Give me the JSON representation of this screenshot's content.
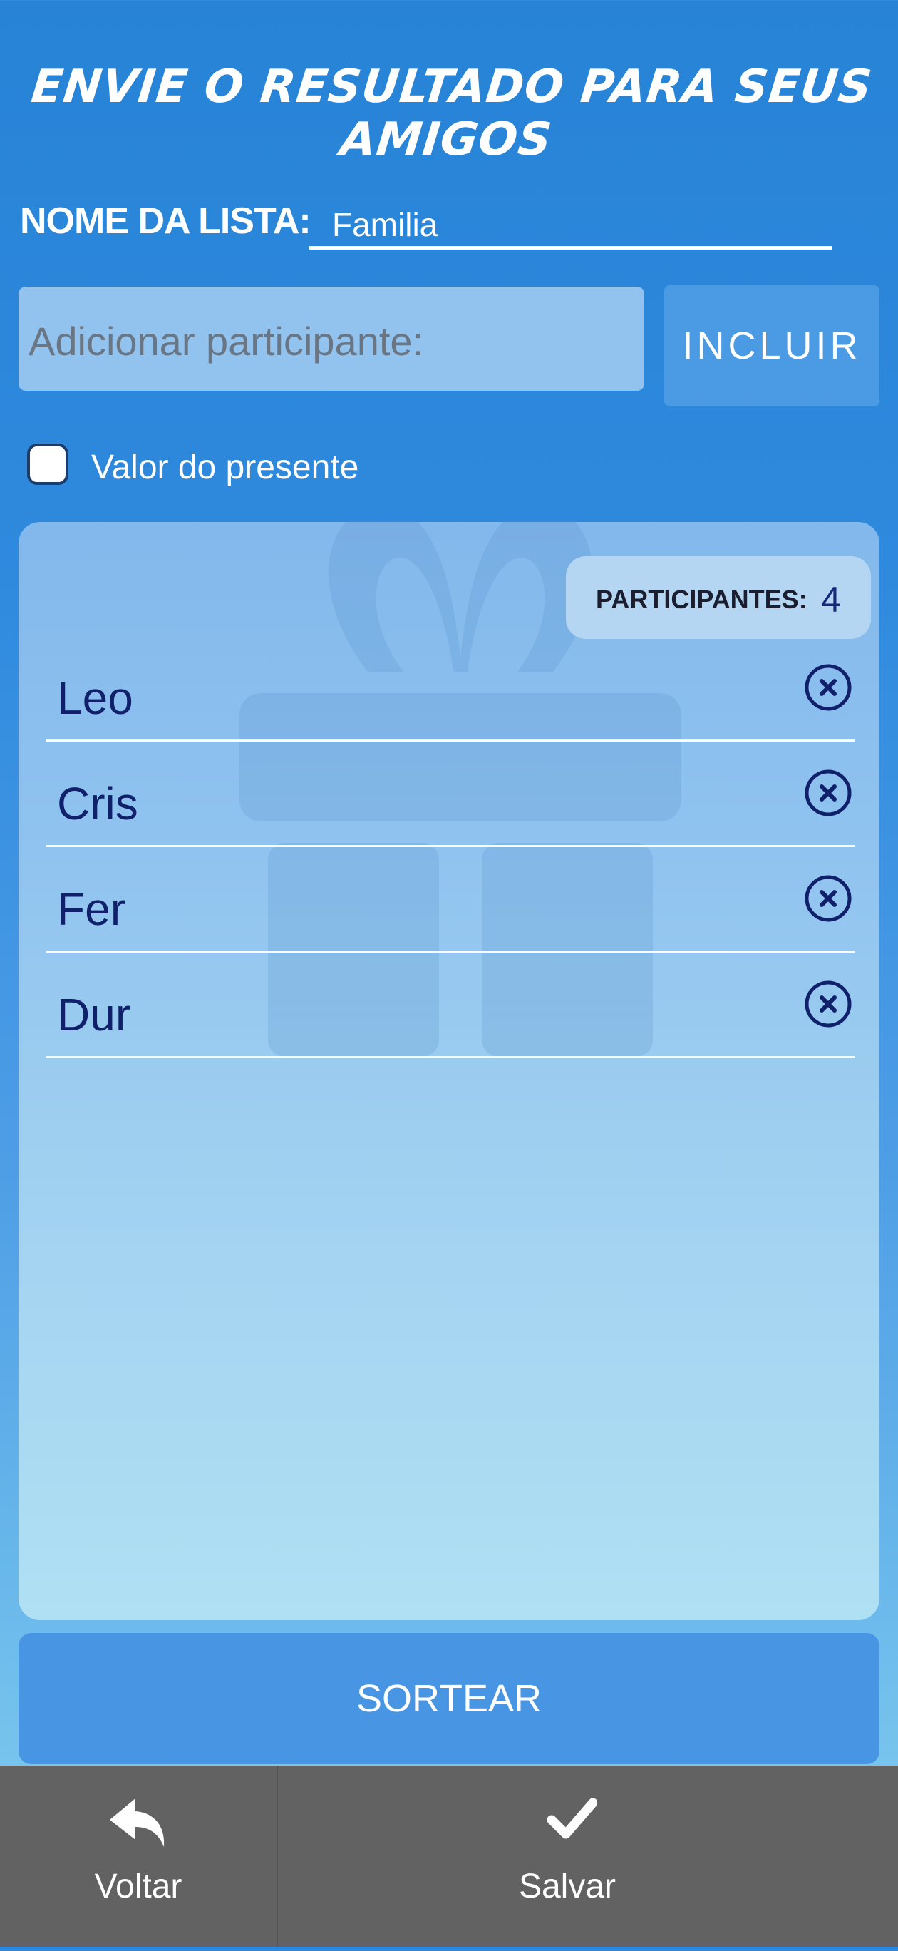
{
  "header": {
    "title": "ENVIE O RESULTADO PARA SEUS AMIGOS"
  },
  "list_name": {
    "label": "NOME DA LISTA:",
    "value": "Familia"
  },
  "add_participant": {
    "placeholder": "Adicionar participante:",
    "button_label": "INCLUIR"
  },
  "gift_value": {
    "label": "Valor do presente",
    "checked": false
  },
  "participants": {
    "count_label": "PARTICIPANTES:",
    "count": "4",
    "items": [
      {
        "name": "Leo",
        "remove_icon": "close-circle-icon"
      },
      {
        "name": "Cris",
        "remove_icon": "close-circle-icon"
      },
      {
        "name": "Fer",
        "remove_icon": "close-circle-icon"
      },
      {
        "name": "Dur",
        "remove_icon": "close-circle-icon"
      }
    ]
  },
  "actions": {
    "draw_label": "SORTEAR"
  },
  "bottom_nav": {
    "back": {
      "label": "Voltar",
      "icon": "reply-arrow-icon"
    },
    "save": {
      "label": "Salvar",
      "icon": "checkmark-icon"
    }
  },
  "colors": {
    "background_top": "#2783d6",
    "background_bottom": "#86d0f0",
    "button_blue": "#4896e3",
    "participant_text": "#10206b",
    "bottom_bar": "#626262"
  }
}
